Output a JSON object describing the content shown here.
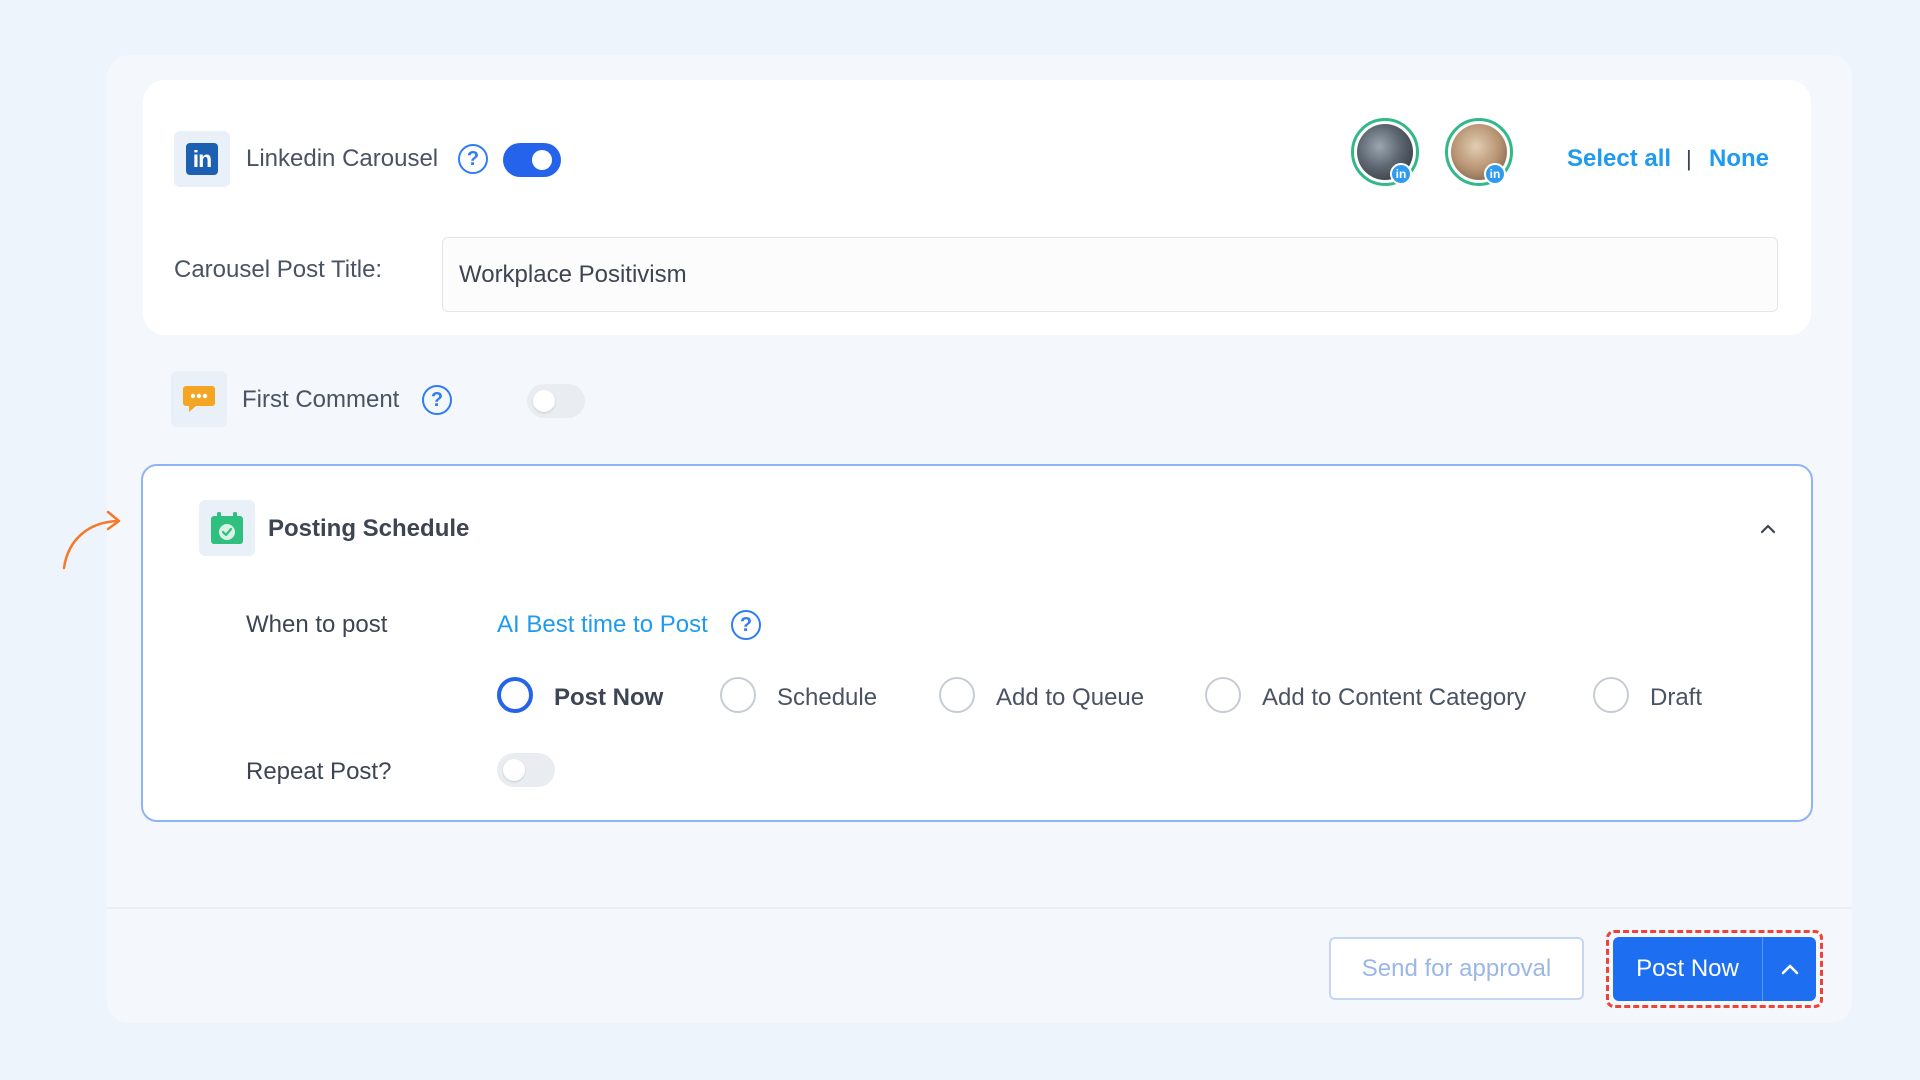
{
  "linkedin": {
    "title": "Linkedin Carousel",
    "logo_text": "in",
    "help": "?",
    "toggle_on": true,
    "accounts": [
      {
        "badge": "in"
      },
      {
        "badge": "in"
      }
    ],
    "select_all": "Select all",
    "separator": "|",
    "none": "None",
    "post_title_label": "Carousel Post Title:",
    "post_title_value": "Workplace Positivism"
  },
  "first_comment": {
    "label": "First Comment",
    "help": "?",
    "toggle_on": false
  },
  "schedule": {
    "title": "Posting Schedule",
    "when_label": "When to post",
    "ai_link": "AI Best time to Post",
    "help": "?",
    "options": [
      {
        "label": "Post Now",
        "selected": true
      },
      {
        "label": "Schedule",
        "selected": false
      },
      {
        "label": "Add to Queue",
        "selected": false
      },
      {
        "label": "Add to Content Category",
        "selected": false
      },
      {
        "label": "Draft",
        "selected": false
      }
    ],
    "repeat_label": "Repeat Post?",
    "repeat_on": false
  },
  "footer": {
    "approval_label": "Send for approval",
    "post_now_label": "Post Now"
  },
  "colors": {
    "accent": "#2563eb",
    "link": "#1e9bf0",
    "avatar_ring": "#33b887",
    "highlight": "#f04335",
    "arrow": "#f47a2a"
  }
}
